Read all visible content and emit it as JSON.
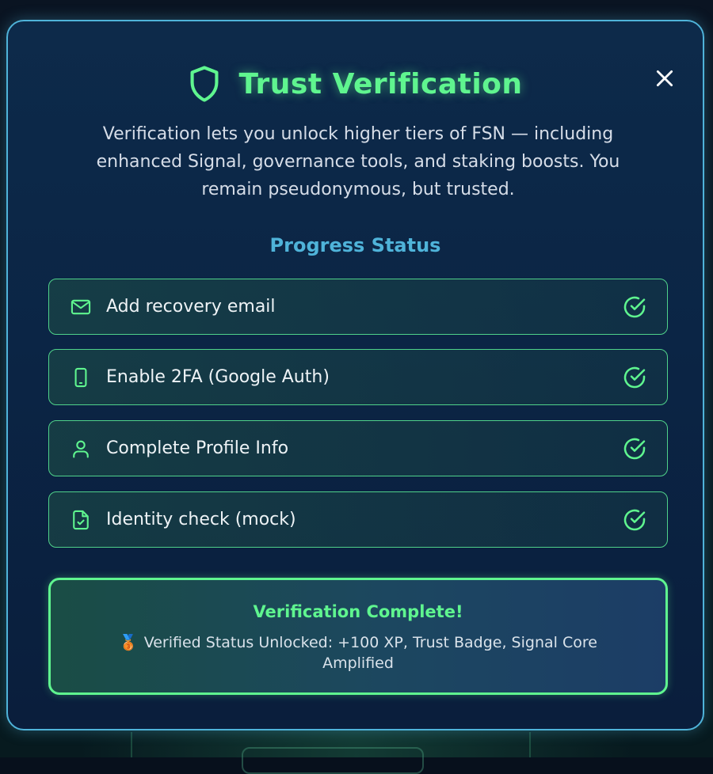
{
  "modal": {
    "title": "Trust Verification",
    "intro": "Verification lets you unlock higher tiers of FSN — including enhanced Signal, governance tools, and staking boosts. You remain pseudonymous, but trusted.",
    "section_title": "Progress Status",
    "steps": [
      {
        "label": "Add recovery email",
        "icon": "mail-icon",
        "status": "complete"
      },
      {
        "label": "Enable 2FA (Google Auth)",
        "icon": "phone-icon",
        "status": "complete"
      },
      {
        "label": "Complete Profile Info",
        "icon": "user-icon",
        "status": "complete"
      },
      {
        "label": "Identity check (mock)",
        "icon": "file-check-icon",
        "status": "complete"
      }
    ],
    "complete": {
      "title": "Verification Complete!",
      "medal": "🥉",
      "body": "Verified Status Unlocked: +100 XP, Trust Badge, Signal Core Amplified"
    }
  },
  "colors": {
    "accent_green": "#5ff58f",
    "accent_blue": "#4fb3d9",
    "modal_bg": "#0b2545"
  }
}
